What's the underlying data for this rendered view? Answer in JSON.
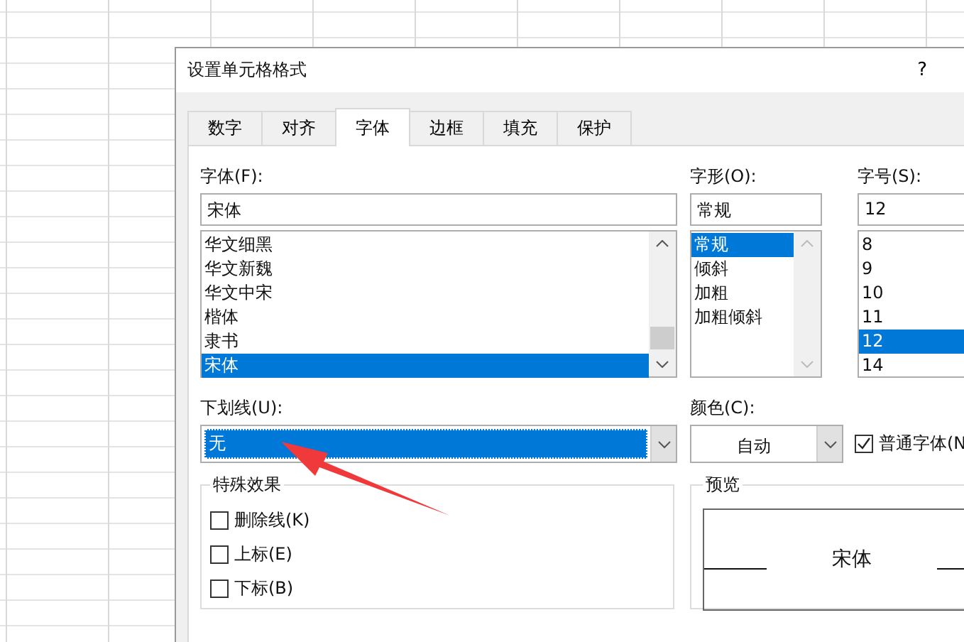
{
  "window": {
    "title": "设置单元格格式",
    "help": "?"
  },
  "tabs": [
    {
      "label": "数字",
      "selected": false
    },
    {
      "label": "对齐",
      "selected": false
    },
    {
      "label": "字体",
      "selected": true
    },
    {
      "label": "边框",
      "selected": false
    },
    {
      "label": "填充",
      "selected": false
    },
    {
      "label": "保护",
      "selected": false
    }
  ],
  "font": {
    "label": "字体(F):",
    "value": "宋体",
    "items": [
      {
        "label": "华文细黑",
        "selected": false
      },
      {
        "label": "华文新魏",
        "selected": false
      },
      {
        "label": "华文中宋",
        "selected": false
      },
      {
        "label": "楷体",
        "selected": false
      },
      {
        "label": "隶书",
        "selected": false
      },
      {
        "label": "宋体",
        "selected": true
      }
    ]
  },
  "style": {
    "label": "字形(O):",
    "value": "常规",
    "items": [
      {
        "label": "常规",
        "selected": true
      },
      {
        "label": "倾斜",
        "selected": false
      },
      {
        "label": "加粗",
        "selected": false
      },
      {
        "label": "加粗倾斜",
        "selected": false
      }
    ]
  },
  "size": {
    "label": "字号(S):",
    "value": "12",
    "items": [
      {
        "label": "8",
        "selected": false
      },
      {
        "label": "9",
        "selected": false
      },
      {
        "label": "10",
        "selected": false
      },
      {
        "label": "11",
        "selected": false
      },
      {
        "label": "12",
        "selected": true
      },
      {
        "label": "14",
        "selected": false
      }
    ]
  },
  "underline": {
    "label": "下划线(U):",
    "value": "无",
    "highlighted": true
  },
  "color": {
    "label": "颜色(C):",
    "value": "自动"
  },
  "normal_font": {
    "label": "普通字体(N",
    "checked": true
  },
  "effects": {
    "title": "特殊效果",
    "options": [
      {
        "label": "删除线(K)",
        "checked": false
      },
      {
        "label": "上标(E)",
        "checked": false
      },
      {
        "label": "下标(B)",
        "checked": false
      }
    ]
  },
  "preview": {
    "title": "预览",
    "sample": "宋体"
  }
}
